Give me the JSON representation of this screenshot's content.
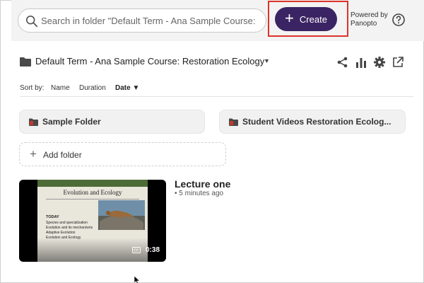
{
  "search": {
    "placeholder": "Search in folder \"Default Term - Ana Sample Course:"
  },
  "header": {
    "create_label": "Create",
    "powered_by": "Powered by Panopto"
  },
  "folder_path": {
    "title": "Default Term - Ana Sample Course: Restoration Ecology"
  },
  "sort": {
    "label": "Sort by:",
    "options": [
      "Name",
      "Duration",
      "Date"
    ],
    "active": "Date ▼"
  },
  "folders": [
    {
      "label": "Sample Folder"
    },
    {
      "label": "Student Videos Restoration Ecolog..."
    }
  ],
  "add_folder_label": "Add folder",
  "video": {
    "title": "Lecture one",
    "meta": "• 5 minutes ago",
    "duration": "0:38",
    "slide": {
      "title": "Evolution and Ecology",
      "heading": "TODAY",
      "bullets": [
        "Species and specialization",
        "Evolution and its mechanisms",
        "Adaptive Evolution",
        "Evolution and Ecology"
      ]
    }
  },
  "colors": {
    "accent": "#3b2463",
    "highlight": "#d9342b",
    "folder": "#4a4a4a",
    "folder_red": "#c0392b"
  },
  "icons": [
    "search-icon",
    "plus-icon",
    "help-icon",
    "folder-icon",
    "chevron-down-icon",
    "share-icon",
    "stats-icon",
    "settings-icon",
    "open-external-icon",
    "captions-icon"
  ]
}
